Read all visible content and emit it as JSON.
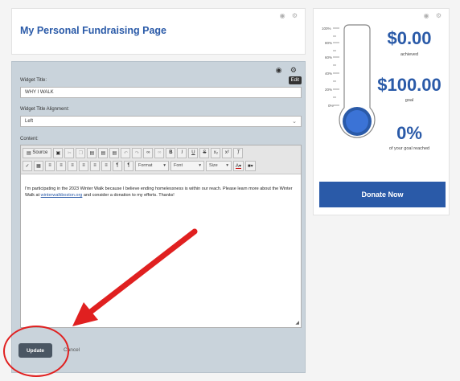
{
  "title_widget": {
    "title": "My Personal Fundraising Page",
    "icons": "◉ ⚙"
  },
  "editor": {
    "icons": "◉ ⚙",
    "edit_tooltip": "Edit",
    "widget_title_label": "Widget Title:",
    "widget_title_value": "WHY I WALK",
    "alignment_label": "Widget Title Alignment:",
    "alignment_value": "Left",
    "content_label": "Content:",
    "toolbar": {
      "source": "Source",
      "format": "Format",
      "font": "Font",
      "size": "Size"
    },
    "body_text_1": "I'm participating in the 2023 Winter Walk because I believe ending homelessness is within our reach.  Please learn more about the Winter Walk at ",
    "body_link": "winterwalkboston.org",
    "body_text_2": " and consider a donation to my efforts.  Thanks!",
    "update_label": "Update",
    "cancel_label": "Cancel"
  },
  "thermometer_widget": {
    "icons": "◉ ⚙",
    "achieved_amount": "$0.00",
    "achieved_label": "achieved",
    "goal_amount": "$100.00",
    "goal_label": "goal",
    "percent": "0%",
    "percent_label": "of your goal reached",
    "progress": 0,
    "scale_ticks": [
      "100%",
      "80%",
      "60%",
      "40%",
      "20%",
      "0%"
    ],
    "donate_label": "Donate Now"
  },
  "colors": {
    "accent": "#2a5aa8",
    "annotation": "#e02020",
    "panel": "#c9d3db"
  }
}
